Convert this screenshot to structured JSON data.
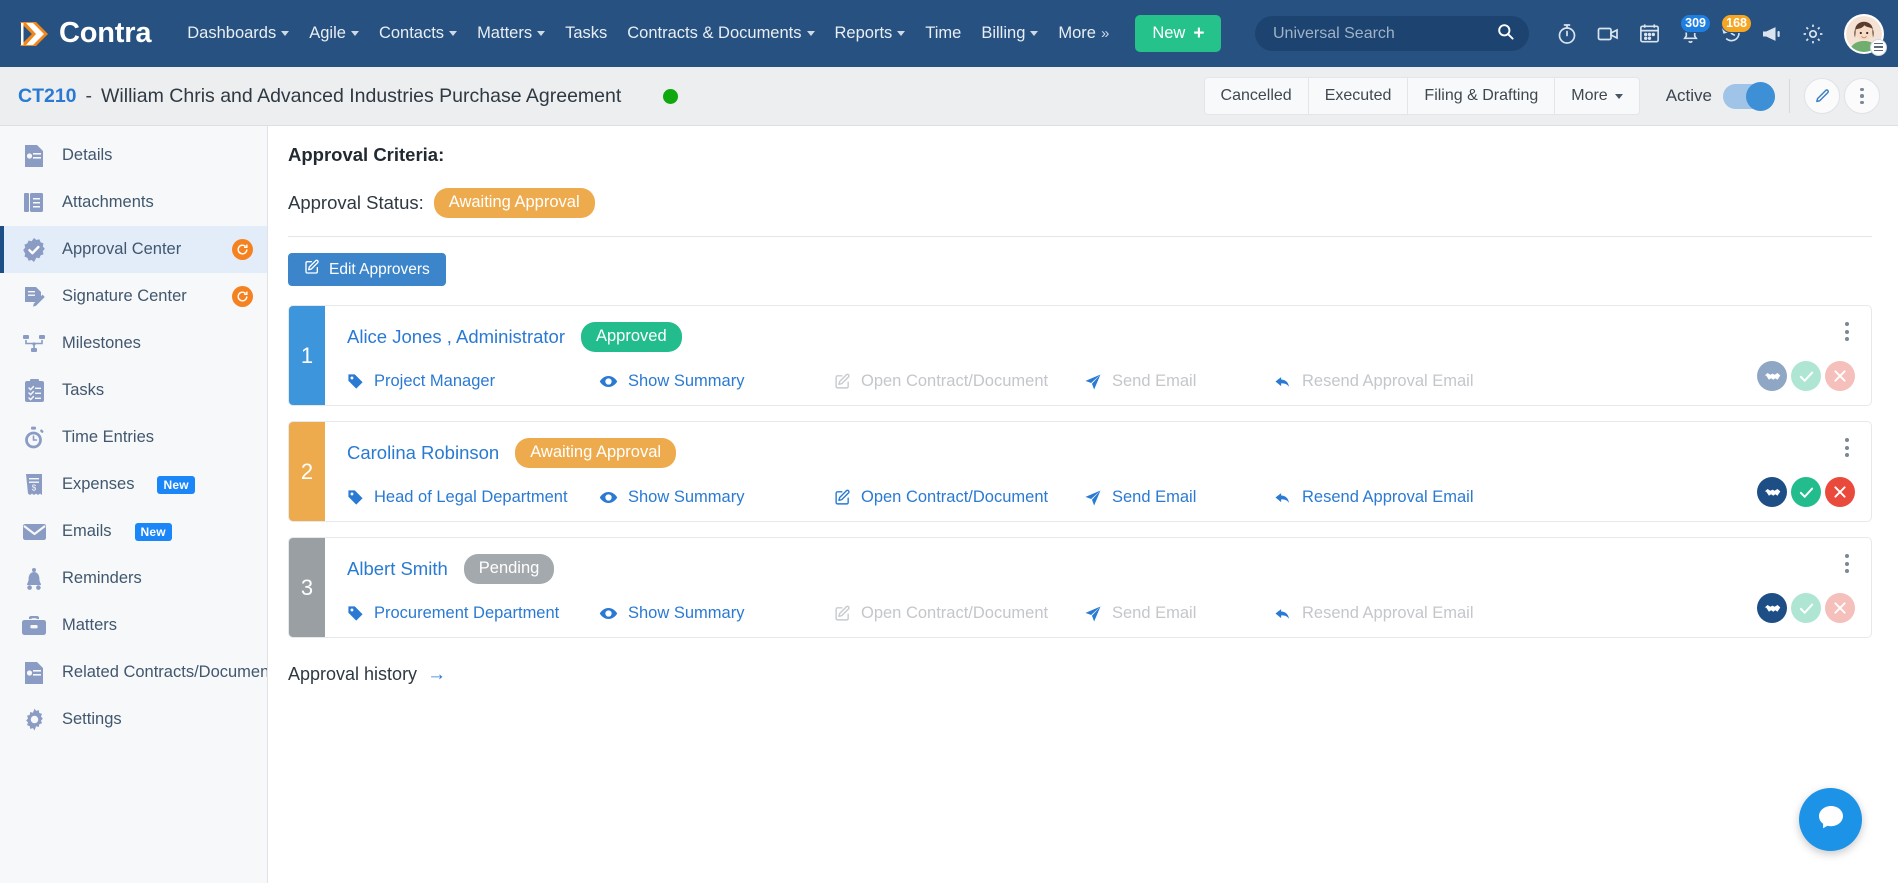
{
  "topnav": {
    "brand": "Contra",
    "links": [
      {
        "label": "Dashboards",
        "caret": true
      },
      {
        "label": "Agile",
        "caret": true
      },
      {
        "label": "Contacts",
        "caret": true
      },
      {
        "label": "Matters",
        "caret": true
      },
      {
        "label": "Tasks",
        "caret": false
      },
      {
        "label": "Contracts & Documents",
        "caret": true
      },
      {
        "label": "Reports",
        "caret": true
      },
      {
        "label": "Time",
        "caret": false
      },
      {
        "label": "Billing",
        "caret": true
      },
      {
        "label": "More",
        "caret": false,
        "dblcaret": true
      }
    ],
    "new_button": "New",
    "search_placeholder": "Universal Search",
    "icons": [
      "stopwatch-icon",
      "video-camera-icon",
      "calendar-icon",
      "bell-icon",
      "history-clock-icon",
      "megaphone-icon",
      "gear-icon"
    ],
    "bell_badge": "309",
    "history_badge": "168",
    "accent_green": "#25c28c",
    "nav_background": "#265180"
  },
  "subheader": {
    "contract_id": "CT210",
    "separator": "-",
    "title": "William Chris and Advanced Industries Purchase Agreement",
    "status_dot_color": "#0fa80f",
    "buttons": [
      {
        "label": "Cancelled",
        "caret": false
      },
      {
        "label": "Executed",
        "caret": false
      },
      {
        "label": "Filing & Drafting",
        "caret": false
      },
      {
        "label": "More",
        "caret": true
      }
    ],
    "active_label": "Active",
    "active_on": true,
    "edit_icon": "pencil-icon",
    "more_icon": "vertical-dots-icon"
  },
  "sidebar": {
    "items": [
      {
        "label": "Details",
        "icon": "document-details-icon",
        "active": false,
        "tag": null,
        "sync": false
      },
      {
        "label": "Attachments",
        "icon": "attachments-icon",
        "active": false,
        "tag": null,
        "sync": false
      },
      {
        "label": "Approval Center",
        "icon": "approval-badge-icon",
        "active": true,
        "tag": null,
        "sync": true
      },
      {
        "label": "Signature Center",
        "icon": "signature-icon",
        "active": false,
        "tag": null,
        "sync": true
      },
      {
        "label": "Milestones",
        "icon": "milestones-icon",
        "active": false,
        "tag": null,
        "sync": false
      },
      {
        "label": "Tasks",
        "icon": "clipboard-checklist-icon",
        "active": false,
        "tag": null,
        "sync": false
      },
      {
        "label": "Time Entries",
        "icon": "stopwatch-icon",
        "active": false,
        "tag": null,
        "sync": false
      },
      {
        "label": "Expenses",
        "icon": "receipt-icon",
        "active": false,
        "tag": "New",
        "sync": false
      },
      {
        "label": "Emails",
        "icon": "envelope-icon",
        "active": false,
        "tag": "New",
        "sync": false
      },
      {
        "label": "Reminders",
        "icon": "bell-icon",
        "active": false,
        "tag": null,
        "sync": false
      },
      {
        "label": "Matters",
        "icon": "briefcase-icon",
        "active": false,
        "tag": null,
        "sync": false
      },
      {
        "label": "Related Contracts/Documents",
        "icon": "document-details-icon",
        "active": false,
        "tag": null,
        "sync": false
      },
      {
        "label": "Settings",
        "icon": "gear-icon",
        "active": false,
        "tag": null,
        "sync": false
      }
    ]
  },
  "main": {
    "criteria_title": "Approval Criteria:",
    "status_label": "Approval Status:",
    "status_value": "Awaiting Approval",
    "status_color": "#eeab4d",
    "edit_approvers_label": "Edit Approvers",
    "history_label": "Approval history",
    "history_arrow": "→",
    "approvers": [
      {
        "number": "1",
        "name": "Alice Jones , Administrator",
        "status": "Approved",
        "status_kind": "green",
        "bar_color": "#3d95db",
        "role": "Project Manager",
        "role_enabled": true,
        "action_summary": "Show Summary",
        "summary_enabled": true,
        "action_open": "Open Contract/Document",
        "open_enabled": false,
        "action_email": "Send Email",
        "email_enabled": false,
        "action_resend": "Resend Approval Email",
        "resend_enabled": false,
        "handshake_enabled": false,
        "approve_enabled": false,
        "reject_enabled": false
      },
      {
        "number": "2",
        "name": "Carolina Robinson",
        "status": "Awaiting Approval",
        "status_kind": "amber",
        "bar_color": "#eeab4d",
        "role": "Head of Legal Department",
        "role_enabled": true,
        "action_summary": "Show Summary",
        "summary_enabled": true,
        "action_open": "Open Contract/Document",
        "open_enabled": true,
        "action_email": "Send Email",
        "email_enabled": true,
        "action_resend": "Resend Approval Email",
        "resend_enabled": true,
        "handshake_enabled": true,
        "approve_enabled": true,
        "reject_enabled": true
      },
      {
        "number": "3",
        "name": "Albert Smith",
        "status": "Pending",
        "status_kind": "grey",
        "bar_color": "#9a9fa4",
        "role": "Procurement Department",
        "role_enabled": true,
        "action_summary": "Show Summary",
        "summary_enabled": true,
        "action_open": "Open Contract/Document",
        "open_enabled": false,
        "action_email": "Send Email",
        "email_enabled": false,
        "action_resend": "Resend Approval Email",
        "resend_enabled": false,
        "handshake_enabled": true,
        "approve_enabled": false,
        "reject_enabled": false
      }
    ],
    "chat_icon": "chat-bubble-icon"
  }
}
